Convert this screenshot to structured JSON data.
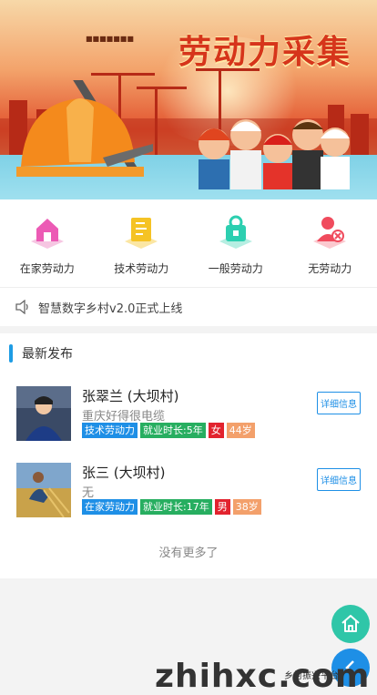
{
  "banner": {
    "title": "劳动力采集",
    "subtitle": "■■■■■■■"
  },
  "categories": [
    {
      "label": "在家劳动力",
      "icon": "home-icon",
      "color": "#ec5bb5"
    },
    {
      "label": "技术劳动力",
      "icon": "tech-icon",
      "color": "#f5c325"
    },
    {
      "label": "一般劳动力",
      "icon": "general-icon",
      "color": "#2ccfb0"
    },
    {
      "label": "无劳动力",
      "icon": "no-labor-icon",
      "color": "#f04b5d"
    }
  ],
  "notice": {
    "text": "智慧数字乡村v2.0正式上线"
  },
  "latest": {
    "title": "最新发布",
    "items": [
      {
        "name": "张翠兰 (大坝村)",
        "desc": "重庆好得很电缆",
        "tags": [
          "技术劳动力",
          "就业时长:5年",
          "女",
          "44岁"
        ],
        "button": "详细信息"
      },
      {
        "name": "张三 (大坝村)",
        "desc": "无",
        "tags": [
          "在家劳动力",
          "就业时长:17年",
          "男",
          "38岁"
        ],
        "button": "详细信息"
      }
    ],
    "no_more": "没有更多了"
  },
  "watermark": {
    "text": "zhihxc.com",
    "small": "乡村振兴平台"
  }
}
